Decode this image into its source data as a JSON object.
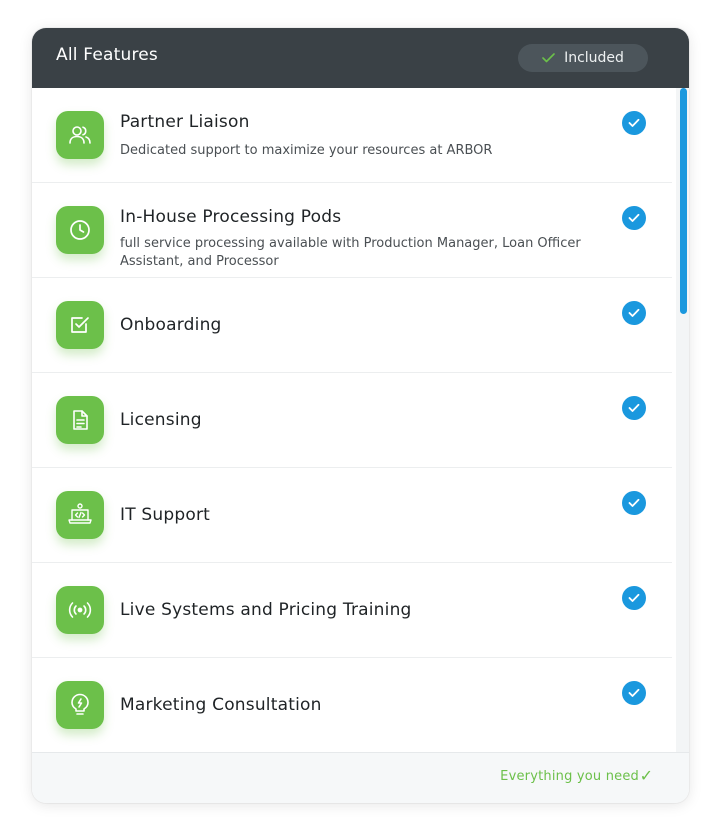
{
  "header": {
    "title": "All Features",
    "badge_label": "Included"
  },
  "features": [
    {
      "title": "Partner Liaison",
      "description": "Dedicated support to maximize your resources at ARBOR",
      "icon": "users-icon",
      "included": true
    },
    {
      "title": "In-House Processing Pods",
      "description": "full service processing available with Production Manager, Loan Officer Assistant, and Processor",
      "icon": "clock-icon",
      "included": true
    },
    {
      "title": "Onboarding",
      "description": "",
      "icon": "checkbox-icon",
      "included": true
    },
    {
      "title": "Licensing",
      "description": "",
      "icon": "document-icon",
      "included": true
    },
    {
      "title": "IT Support",
      "description": "",
      "icon": "code-laptop-icon",
      "included": true
    },
    {
      "title": "Live Systems and Pricing Training",
      "description": "",
      "icon": "broadcast-icon",
      "included": true
    },
    {
      "title": "Marketing Consultation",
      "description": "",
      "icon": "lightbulb-icon",
      "included": true
    }
  ],
  "footer": {
    "text": "Everything you need",
    "check_glyph": "✓"
  },
  "colors": {
    "header_bg": "#3a4146",
    "accent_green": "#6cc04a",
    "check_blue": "#1a98de"
  }
}
